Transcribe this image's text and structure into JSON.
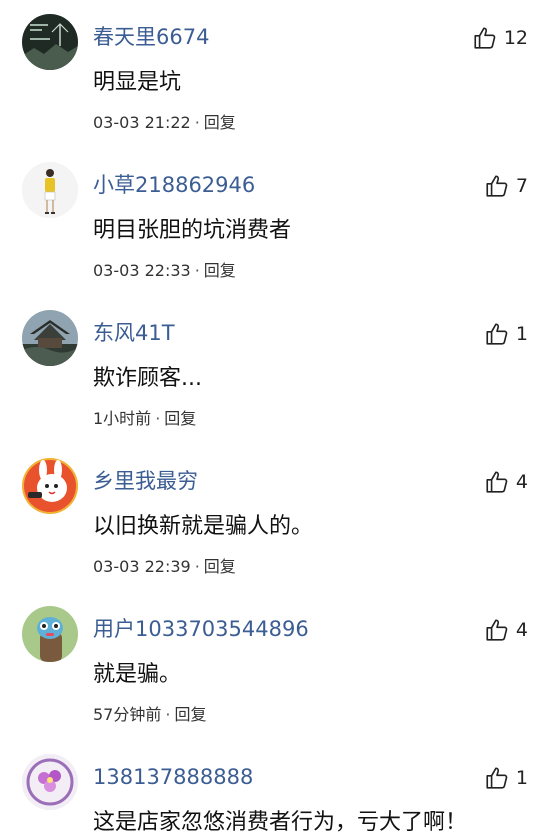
{
  "comments": [
    {
      "user": "春天里6674",
      "text": "明显是坑",
      "time": "03-03 21:22",
      "reply": "回复",
      "likes": "12",
      "avatar": "tree-landscape-avatar"
    },
    {
      "user": "小草218862946",
      "text": "明目张胆的坑消费者",
      "time": "03-03 22:33",
      "reply": "回复",
      "likes": "7",
      "avatar": "girl-figure-avatar"
    },
    {
      "user": "东风41T",
      "text": "欺诈顾客...",
      "time": "1小时前",
      "reply": "回复",
      "likes": "1",
      "avatar": "pagoda-avatar"
    },
    {
      "user": "乡里我最穷",
      "text": "以旧换新就是骗人的。",
      "time": "03-03 22:39",
      "reply": "回复",
      "likes": "4",
      "avatar": "cartoon-rabbit-avatar"
    },
    {
      "user": "用户1033703544896",
      "text": "就是骗。",
      "time": "57分钟前",
      "reply": "回复",
      "likes": "4",
      "avatar": "cartoon-creature-avatar"
    },
    {
      "user": "138137888888",
      "text": "这是店家忽悠消费者行为，亏大了啊！",
      "likes": "1",
      "avatar": "purple-flower-avatar"
    }
  ],
  "separator": "·"
}
